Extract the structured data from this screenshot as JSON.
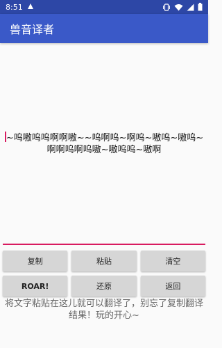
{
  "status_bar": {
    "time": "8:51",
    "icons": [
      "notification-icon",
      "vibrate-icon",
      "wifi-icon",
      "signal-icon",
      "battery-icon"
    ]
  },
  "app_bar": {
    "title": "兽音译者"
  },
  "editor": {
    "text": "~呜嗷呜呜啊啊嗷~~呜啊呜~啊呜~嗷呜~嗷呜~啊啊呜啊呜嗷~嗷呜呜~嗷啊"
  },
  "buttons": {
    "copy": "复制",
    "paste": "粘贴",
    "clear": "清空",
    "roar": "ROAR!",
    "restore": "还原",
    "back": "返回"
  },
  "hint": "将文字粘贴在这儿就可以翻译了，别忘了复制翻译结果！玩的开心~",
  "colors": {
    "status_bar": "#2d47a6",
    "app_bar": "#3a59c8",
    "accent": "#d81b60",
    "button": "#d6d6d6"
  }
}
